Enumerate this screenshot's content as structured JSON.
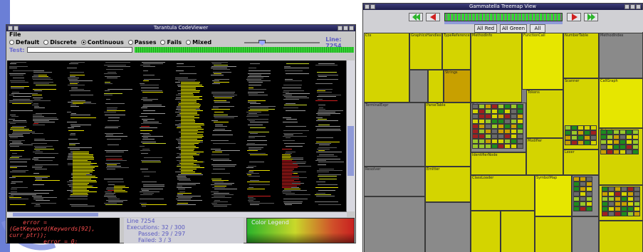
{
  "codeviewer": {
    "title": "Tarantula CodeViewer",
    "menu": "File",
    "modes": [
      "Default",
      "Discrete",
      "Continuous",
      "Passes",
      "Fails",
      "Mixed"
    ],
    "selected_mode": "Continuous",
    "line_label": "Line: 7254",
    "test_label": "Test:",
    "source_snippet": "    error =\n(GetKeyword(Keywords[92],\ncurr_ptr));\n          error = 0;",
    "stats": {
      "line": "Line 7254",
      "executions": "Executions: 32 / 300",
      "passed": "Passed: 29 / 297",
      "failed": "Failed: 3 / 3"
    },
    "legend_label": "Color Legend"
  },
  "treemap": {
    "title": "Gammatella Treemap View",
    "buttons": [
      "All Red",
      "All Green",
      "All"
    ],
    "cell_labels": [
      "Ctx",
      "GraphicsHandles",
      "TypeReference",
      "MethodInfo",
      "FunctionCall",
      "NumberTable",
      "MethodIndex",
      "Strings",
      "TerminalExpr",
      "ParseTable",
      "Rules",
      "Tokens",
      "Scanner",
      "CallGraph",
      "Outputs",
      "Modifier",
      "IdentifierNode",
      "Lexer",
      "Resolver",
      "Emitter",
      "ClassLoader",
      "SymbolMap"
    ]
  },
  "colors": {
    "pass": "#2ab32a",
    "fail": "#d02020",
    "mixed": "#e8e000"
  }
}
